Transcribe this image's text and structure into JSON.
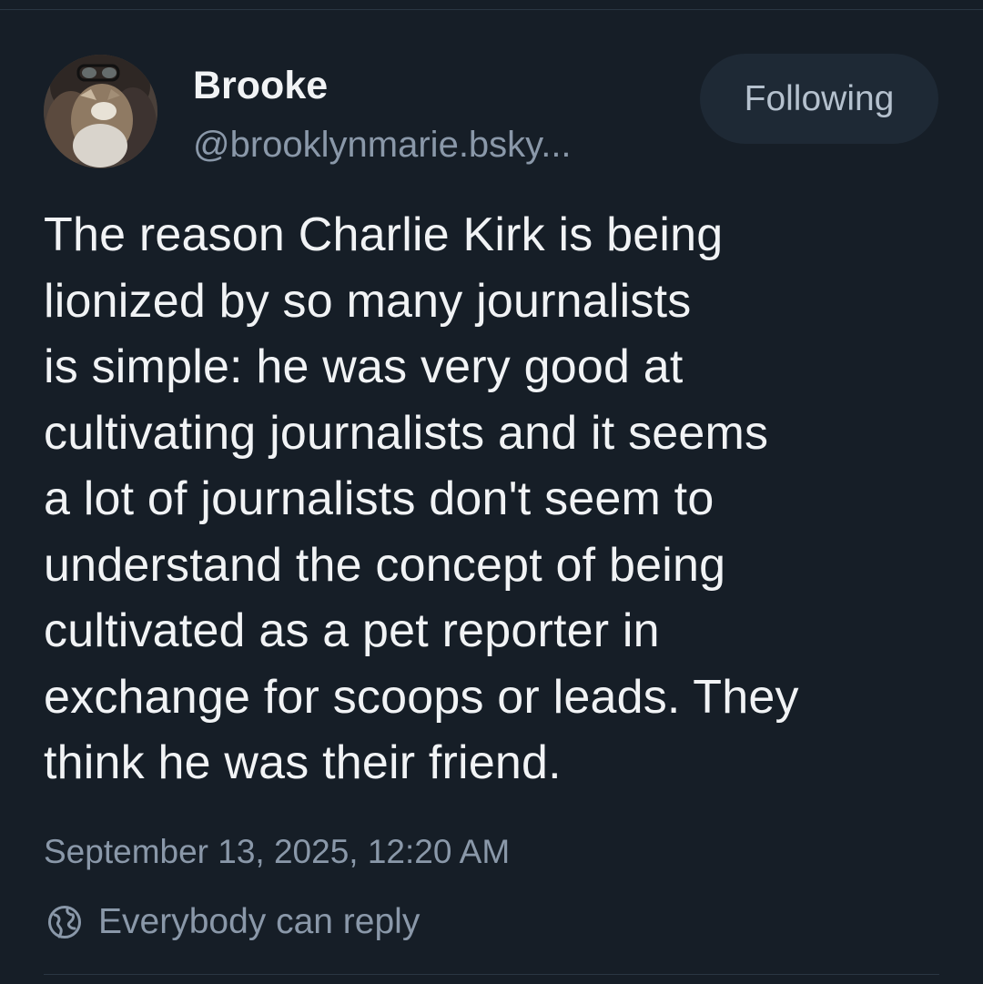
{
  "post": {
    "author": {
      "display_name": "Brooke",
      "handle": "@brooklynmarie.bsky..."
    },
    "follow_button_label": "Following",
    "text": "The reason Charlie Kirk is being\nlionized by so many journalists\nis simple: he was very good at\ncultivating journalists and it seems\na lot of journalists don't seem to\nunderstand the concept of being\ncultivated as a pet reporter in\nexchange for scoops or leads. They\nthink he was their friend.",
    "timestamp": "September 13, 2025, 12:20 AM",
    "reply_setting": {
      "icon": "globe-icon",
      "label": "Everybody can reply"
    }
  },
  "colors": {
    "background": "#161e27",
    "text_primary": "#f1f3f5",
    "text_secondary": "#8a98a9",
    "button_background": "#1e2935"
  }
}
